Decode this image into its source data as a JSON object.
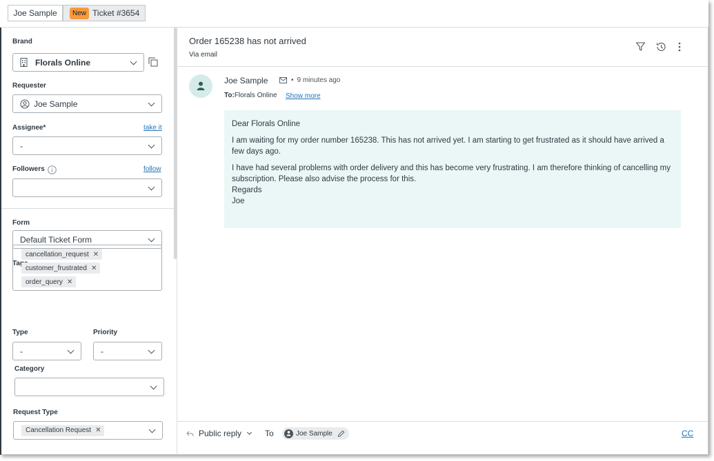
{
  "tabs": {
    "user": "Joe Sample",
    "ticket_badge": "New",
    "ticket": "Ticket #3654"
  },
  "sidebar": {
    "brand_label": "Brand",
    "brand_value": "Florals Online",
    "requester_label": "Requester",
    "requester_value": "Joe Sample",
    "assignee_label": "Assignee*",
    "assignee_link": "take it",
    "assignee_value": "-",
    "followers_label": "Followers",
    "followers_link": "follow",
    "form_label": "Form",
    "form_value": "Default Ticket Form",
    "tags_label": "Tags",
    "tags": [
      "cancellation_request",
      "customer_frustrated",
      "order_query"
    ],
    "type_label": "Type",
    "type_value": "-",
    "priority_label": "Priority",
    "priority_value": "-",
    "category_label": "Category",
    "request_type_label": "Request Type",
    "request_type_value": "Cancellation Request"
  },
  "ticket": {
    "subject": "Order 165238 has not arrived",
    "via": "Via email",
    "author": "Joe Sample",
    "time": "9 minutes ago",
    "to_prefix": "To:",
    "to_value": "Florals Online",
    "show_more": "Show more",
    "body": {
      "greeting": "Dear Florals Online",
      "para1": "I am waiting for my order number 165238. This has not arrived yet. I am starting to get frustrated as it should have arrived a few days ago.",
      "para2": "I have had several problems with order delivery and this has become very frustrating. I am therefore thinking of cancelling my subscription. Please also advise the process for this.",
      "regards": "Regards",
      "sign": "Joe"
    }
  },
  "composer": {
    "reply_mode": "Public reply",
    "to_label": "To",
    "recipient": "Joe Sample",
    "cc": "CC"
  },
  "colors": {
    "accent_link": "#1f73b7",
    "badge_new": "#f79a3e",
    "message_bg": "#eaf7f6",
    "avatar_bg": "#d5ebea"
  },
  "icons": [
    "building-icon",
    "copy-icon",
    "user-circle-icon",
    "info-icon",
    "filter-icon",
    "history-icon",
    "more-vertical-icon",
    "person-icon",
    "envelope-icon",
    "reply-arrow-icon",
    "pencil-icon"
  ]
}
